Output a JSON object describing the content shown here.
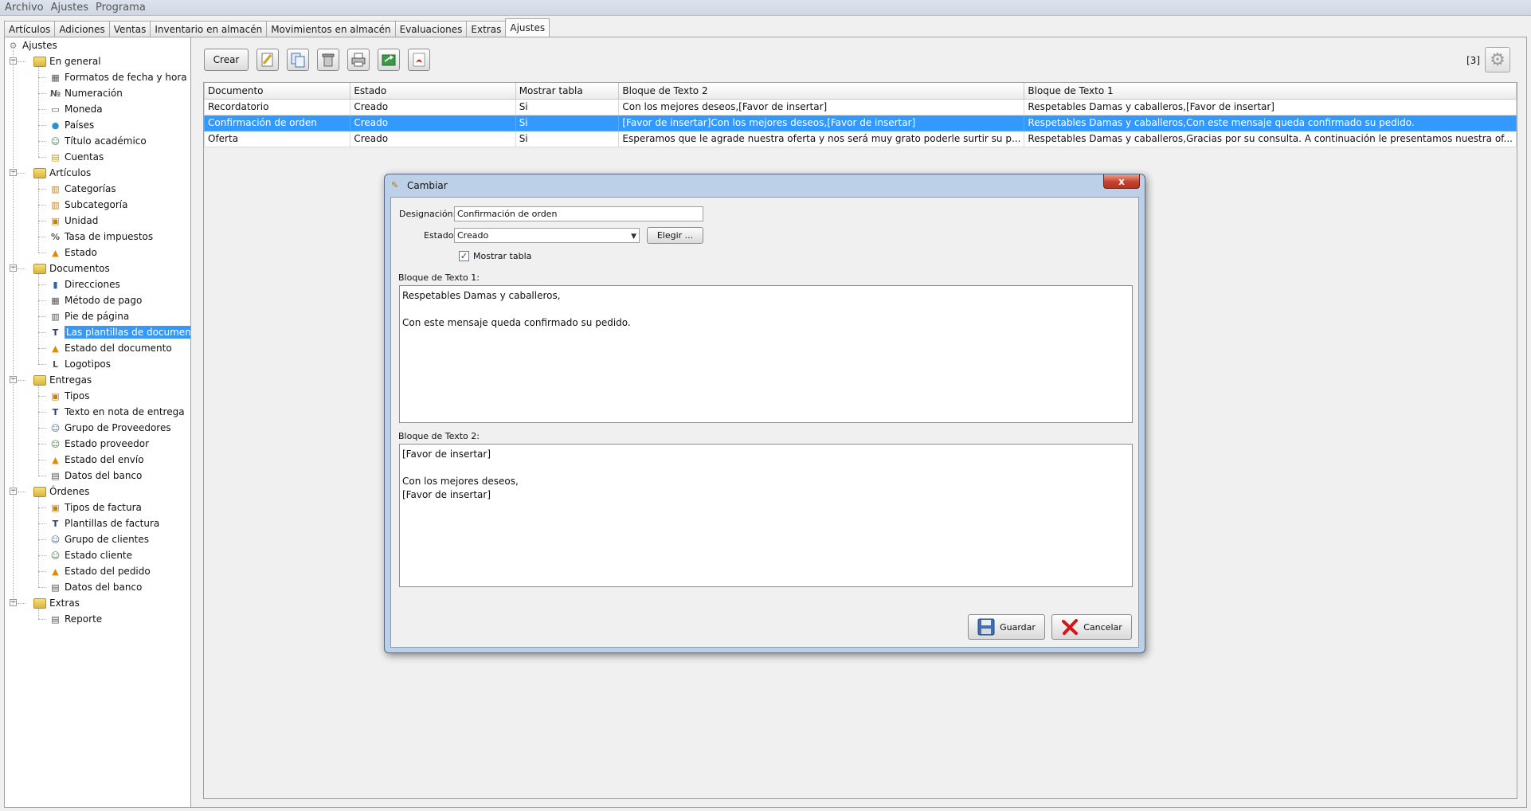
{
  "menu": [
    "Archivo",
    "Ajustes",
    "Programa"
  ],
  "tabs": [
    {
      "label": "Artículos"
    },
    {
      "label": "Adiciones"
    },
    {
      "label": "Ventas"
    },
    {
      "label": "Inventario en almacén"
    },
    {
      "label": "Movimientos en almacén"
    },
    {
      "label": "Evaluaciones"
    },
    {
      "label": "Extras"
    },
    {
      "label": "Ajustes",
      "active": true
    }
  ],
  "tree": {
    "root": "Ajustes",
    "groups": [
      {
        "label": "En general",
        "items": [
          {
            "label": "Formatos de fecha y hora",
            "icon": "calendar-icon"
          },
          {
            "label": "Numeración",
            "icon": "number-icon"
          },
          {
            "label": "Moneda",
            "icon": "money-icon"
          },
          {
            "label": "Países",
            "icon": "globe-icon"
          },
          {
            "label": "Título académico",
            "icon": "person-icon"
          },
          {
            "label": "Cuentas",
            "icon": "accounts-icon"
          }
        ]
      },
      {
        "label": "Artículos",
        "items": [
          {
            "label": "Categorías",
            "icon": "category-icon"
          },
          {
            "label": "Subcategoría",
            "icon": "subcategory-icon"
          },
          {
            "label": "Unidad",
            "icon": "unit-icon"
          },
          {
            "label": "Tasa de impuestos",
            "icon": "percent-icon"
          },
          {
            "label": "Estado",
            "icon": "warning-icon"
          }
        ]
      },
      {
        "label": "Documentos",
        "items": [
          {
            "label": "Direcciones",
            "icon": "address-book-icon"
          },
          {
            "label": "Método de pago",
            "icon": "payment-icon"
          },
          {
            "label": "Pie de página",
            "icon": "footer-icon"
          },
          {
            "label": "Las plantillas de documentos",
            "icon": "text-icon",
            "selected": true
          },
          {
            "label": "Estado del documento",
            "icon": "warning-icon"
          },
          {
            "label": "Logotipos",
            "icon": "logo-icon"
          }
        ]
      },
      {
        "label": "Entregas",
        "items": [
          {
            "label": "Tipos",
            "icon": "box-icon"
          },
          {
            "label": "Texto en nota de entrega",
            "icon": "text-icon"
          },
          {
            "label": "Grupo de Proveedores",
            "icon": "group-icon"
          },
          {
            "label": "Estado proveedor",
            "icon": "person-icon"
          },
          {
            "label": "Estado del envío",
            "icon": "warning-icon"
          },
          {
            "label": "Datos del banco",
            "icon": "bank-icon"
          }
        ]
      },
      {
        "label": "Órdenes",
        "items": [
          {
            "label": "Tipos de factura",
            "icon": "box-icon"
          },
          {
            "label": "Plantillas de factura",
            "icon": "text-icon"
          },
          {
            "label": "Grupo de clientes",
            "icon": "group-icon"
          },
          {
            "label": "Estado cliente",
            "icon": "person-icon"
          },
          {
            "label": "Estado del pedido",
            "icon": "warning-icon"
          },
          {
            "label": "Datos del banco",
            "icon": "bank-icon"
          }
        ]
      },
      {
        "label": "Extras",
        "items": [
          {
            "label": "Reporte",
            "icon": "report-icon"
          }
        ]
      }
    ]
  },
  "toolbar": {
    "create_label": "Crear",
    "icons": [
      "edit-icon",
      "copy-icon",
      "delete-icon",
      "print-icon",
      "export-icon",
      "pdf-icon"
    ],
    "count": "[3]"
  },
  "table": {
    "columns": [
      "Documento",
      "Estado",
      "Mostrar tabla",
      "Bloque de Texto  2",
      "Bloque de Texto 1"
    ],
    "rows": [
      [
        "Recordatorio",
        "Creado",
        "Si",
        "Con los mejores deseos,[Favor de insertar]",
        "Respetables Damas y caballeros,[Favor de insertar]"
      ],
      [
        "Confirmación de orden",
        "Creado",
        "Si",
        "[Favor de insertar]Con los mejores deseos,[Favor de insertar]",
        "Respetables Damas y caballeros,Con este mensaje queda confirmado su pedido."
      ],
      [
        "Oferta",
        "Creado",
        "Si",
        "Esperamos que le agrade nuestra oferta y nos será muy grato poderle surtir su p...",
        "Respetables Damas y caballeros,Gracias por su consulta. A continuación le presentamos nuestra of..."
      ]
    ],
    "selected_row": 1
  },
  "dialog": {
    "title": "Cambiar",
    "close_label": "x",
    "designation_label": "Designación:",
    "designation_value": "Confirmación de orden",
    "status_label": "Estado:",
    "status_value": "Creado",
    "choose_label": "Elegir ...",
    "show_table_label": "Mostrar tabla",
    "show_table_checked": true,
    "block1_label": "Bloque de Texto 1:",
    "block1_text": "Respetables Damas y caballeros,\n\nCon este mensaje queda confirmado su pedido.",
    "block2_label": "Bloque de Texto  2:",
    "block2_text": "[Favor de insertar]\n\nCon los mejores deseos,\n[Favor de insertar]",
    "save_label": "Guardar",
    "cancel_label": "Cancelar"
  },
  "colors": {
    "selection": "#3399ff",
    "dialog_frame": "#bcd0e8",
    "close_button": "#c4412c"
  }
}
